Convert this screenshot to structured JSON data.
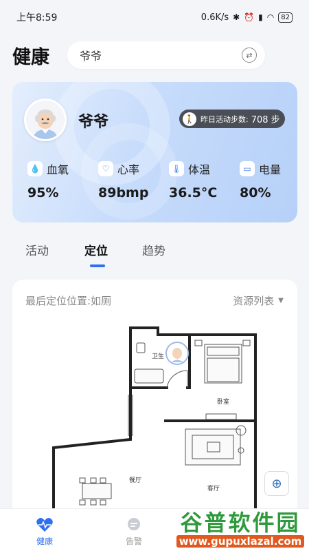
{
  "status": {
    "time": "上午8:59",
    "net_speed": "0.6K/s",
    "battery": "82"
  },
  "header": {
    "title": "健康",
    "search_value": "爷爷"
  },
  "profile": {
    "name": "爷爷",
    "steps_label": "昨日活动步数:",
    "steps_value": "708 步",
    "stats": [
      {
        "label": "血氧",
        "value": "95%",
        "icon": "droplet-icon"
      },
      {
        "label": "心率",
        "value": "89bmp",
        "icon": "heart-rate-icon"
      },
      {
        "label": "体温",
        "value": "36.5°C",
        "icon": "thermometer-icon"
      },
      {
        "label": "电量",
        "value": "80%",
        "icon": "battery-icon"
      }
    ]
  },
  "tabs": [
    {
      "label": "活动"
    },
    {
      "label": "定位"
    },
    {
      "label": "趋势"
    }
  ],
  "location": {
    "last_location": "最后定位位置:如厕",
    "resource_list": "资源列表",
    "rooms": {
      "bathroom": "卫生",
      "bedroom": "卧室",
      "dining": "餐厅",
      "living": "客厅"
    }
  },
  "bottom_nav": [
    {
      "label": "健康"
    },
    {
      "label": "告警"
    }
  ],
  "watermark": {
    "title": "谷普软件园",
    "url": "www.gupuxlazal.com"
  },
  "colors": {
    "accent": "#2f6ff0",
    "card_gradient_start": "#e4eefd",
    "card_gradient_end": "#b6d0f8",
    "steps_pill": "#4a4e56"
  }
}
